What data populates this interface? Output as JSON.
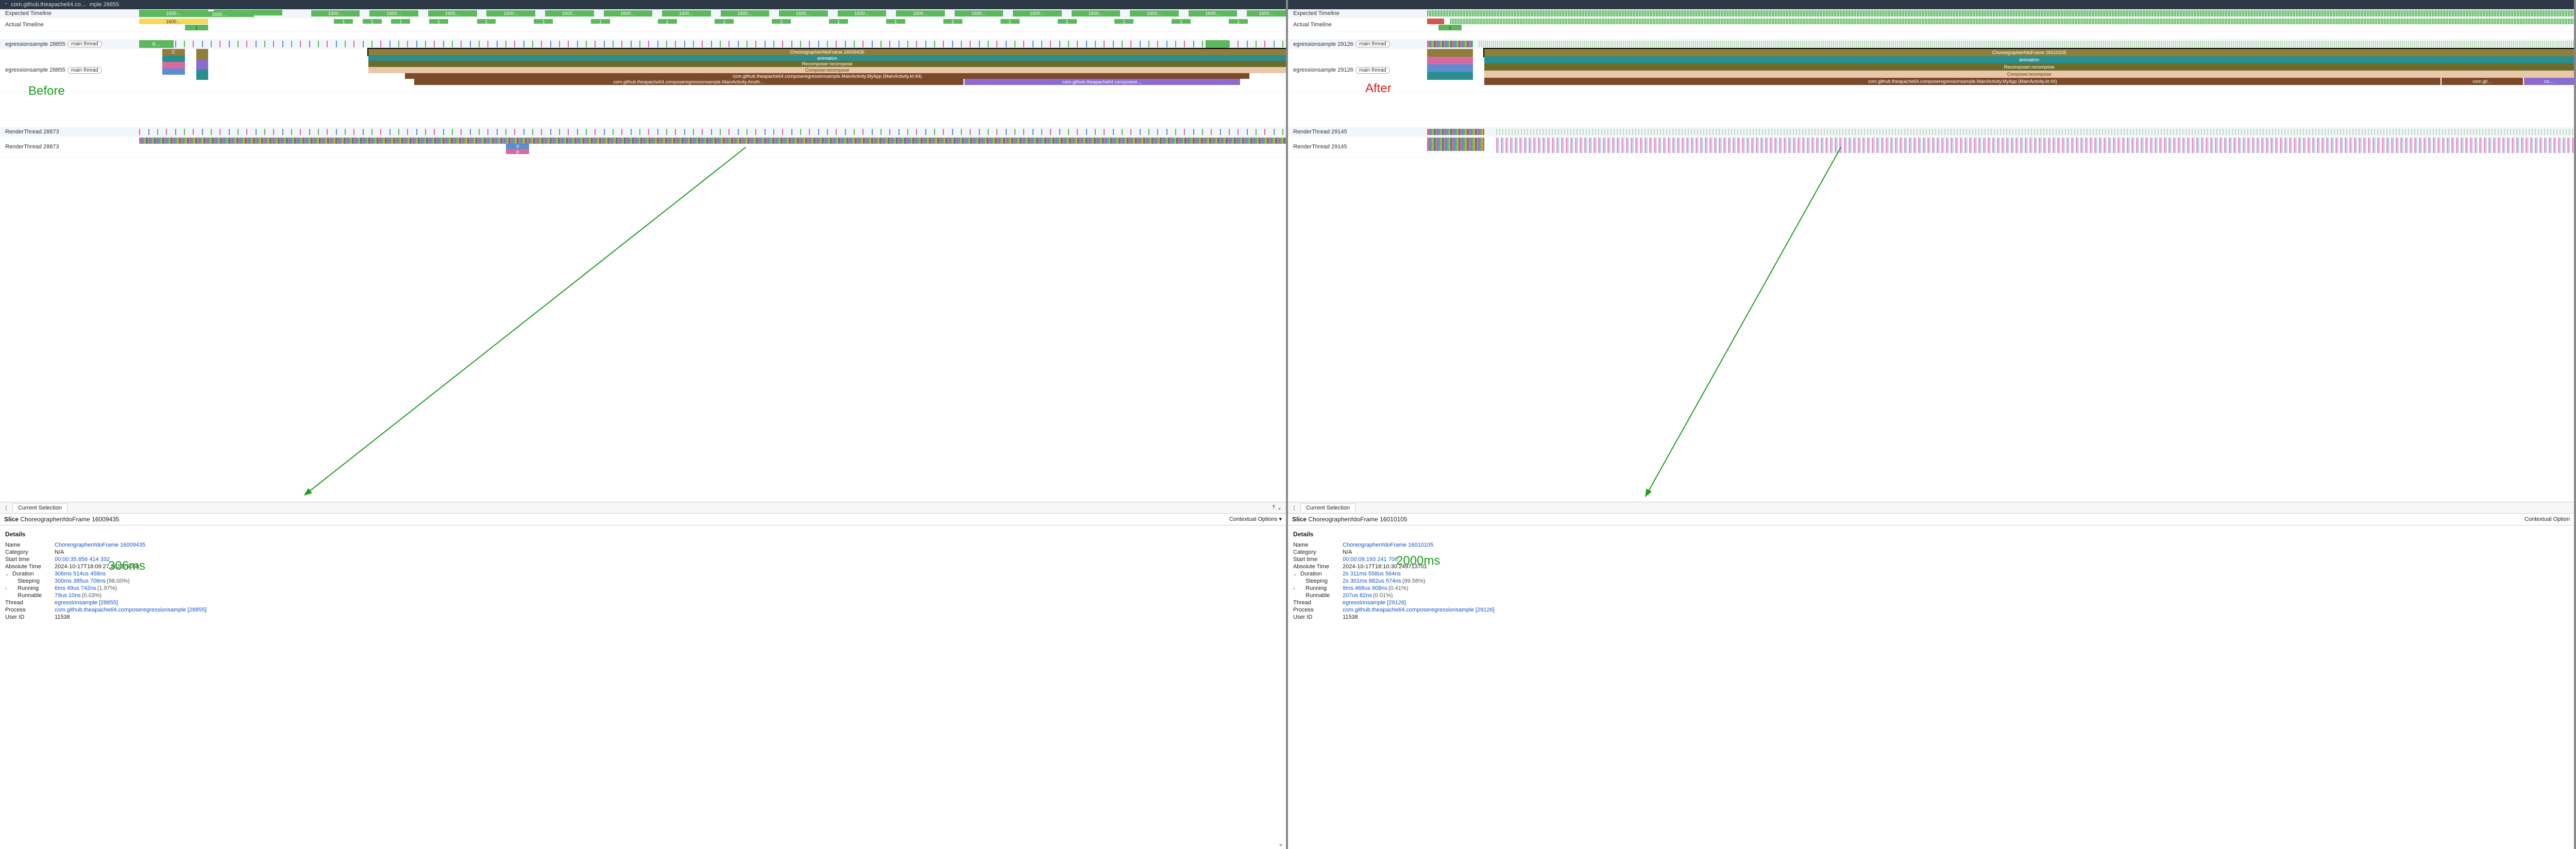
{
  "before": {
    "titlebar": {
      "host": "com.github.theapache64.co…",
      "suffix": "mple 28855"
    },
    "overlay_label": "Before",
    "overlay_metric": "306ms",
    "tracks": {
      "expected_timeline": "Expected Timeline",
      "actual_timeline": "Actual Timeline",
      "thread1": {
        "name": "egressionsample 28855",
        "pill": "main thread"
      },
      "thread2": {
        "name": "egressionsample 28855",
        "pill": "main thread"
      },
      "renderA": "RenderThread 28873",
      "renderB": "RenderThread 28873"
    },
    "timeline_labels": {
      "expected_block": "1600…",
      "actual_block": "1600…",
      "actual_small": "1",
      "frame_top": "Choreographer#doFrame 16009435",
      "frame_anim": "animation",
      "frame_recompose": "Recomposer:recompose",
      "frame_compose": "Compose:recompose",
      "frame_main": "com.github.theapache64.composeregressionsample.MainActivity.MyApp (MainActivity.kt:44)",
      "frame_sub1": "com.github.theapache64.composeregressionsample.MainActivity.Anoth…",
      "frame_sub2": "com.github.theapache64.composere…",
      "tiny_r": "R…",
      "tiny_c": "C",
      "render_d": "d",
      "render_p": "p"
    },
    "tab": "Current Selection",
    "slice_title_prefix": "Slice",
    "slice_title": "Choreographer#doFrame 16009435",
    "contextual": "Contextual Options",
    "details_heading": "Details",
    "rows": {
      "name_k": "Name",
      "name_v": "Choreographer#doFrame 16009435",
      "category_k": "Category",
      "category_v": "N/A",
      "start_k": "Start time",
      "start_v": "00:00:35.656 414 332",
      "abs_k": "Absolute Time",
      "abs_v": "2024-10-17T18:09:27.262575058",
      "dur_k": "Duration",
      "dur_v": "306ms 514us 458ns",
      "sleep_k": "Sleeping",
      "sleep_v": "300ms 385us 706ns",
      "sleep_pct": "(98.00%)",
      "run_k": "Running",
      "run_v": "6ms 49us 742ns",
      "run_pct": "(1.97%)",
      "runnable_k": "Runnable",
      "runnable_v": "79us 10ns",
      "runnable_pct": "(0.03%)",
      "thread_k": "Thread",
      "thread_v": "egressionsample [28855]",
      "process_k": "Process",
      "process_v": "com.github.theapache64.composeregressionsample [28855]",
      "userid_k": "User ID",
      "userid_v": "11538"
    }
  },
  "after": {
    "overlay_label": "After",
    "overlay_metric": "2000ms",
    "tracks": {
      "expected_timeline": "Expected Timeline",
      "actual_timeline": "Actual Timeline",
      "thread1": {
        "name": "egressionsample 29126",
        "pill": "main thread"
      },
      "thread2": {
        "name": "egressionsample 29126",
        "pill": "main thread"
      },
      "renderA": "RenderThread 29145",
      "renderB": "RenderThread 29145"
    },
    "timeline_labels": {
      "actual_small": "1",
      "frame_top": "Choreographer#doFrame 16010105",
      "frame_anim": "animation",
      "frame_recompose": "Recomposer:recompose",
      "frame_compose": "Compose:recompose",
      "frame_main": "com.github.theapache64.composeregressionsample.MainActivity.MyApp (MainActivity.kt:44)",
      "frame_sub1": "com.git…",
      "frame_sub2": "co…"
    },
    "tab": "Current Selection",
    "slice_title_prefix": "Slice",
    "slice_title": "Choreographer#doFrame 16010105",
    "contextual": "Contextual Option",
    "details_heading": "Details",
    "rows": {
      "name_k": "Name",
      "name_v": "Choreographer#doFrame 16010105",
      "category_k": "Category",
      "category_v": "N/A",
      "start_k": "Start time",
      "start_v": "00:00:09.193 241 706",
      "abs_k": "Absolute Time",
      "abs_v": "2024-10-17T18:10:30.249713701",
      "dur_k": "Duration",
      "dur_v": "2s 311ms 558us 564ns",
      "sleep_k": "Sleeping",
      "sleep_v": "2s 301ms 882us 574ns",
      "sleep_pct": "(99.58%)",
      "run_k": "Running",
      "run_v": "9ms 468us 908ns",
      "run_pct": "(0.41%)",
      "runnable_k": "Runnable",
      "runnable_v": "207us 82ns",
      "runnable_pct": "(0.01%)",
      "thread_k": "Thread",
      "thread_v": "egressionsample [29126]",
      "process_k": "Process",
      "process_v": "com.github.theapache64.composeregressionsample [29126]",
      "userid_k": "User ID",
      "userid_v": "11538"
    }
  }
}
